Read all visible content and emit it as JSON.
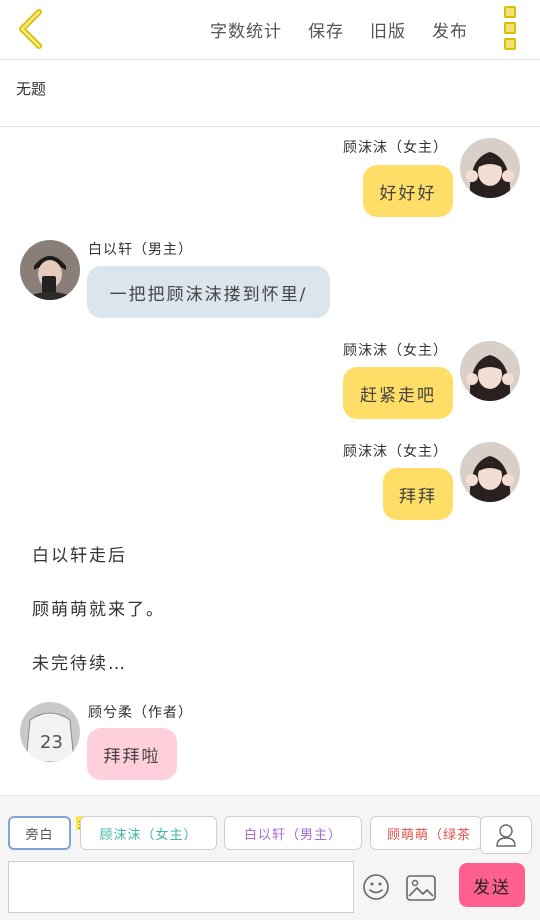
{
  "header": {
    "actions": [
      "字数统计",
      "保存",
      "旧版",
      "发布"
    ]
  },
  "title": "无题",
  "messages": [
    {
      "name": "顾沫沫（女主）",
      "text": "好好好"
    },
    {
      "name": "白以轩（男主）",
      "text": "一把把顾沫沫搂到怀里/"
    },
    {
      "name": "顾沫沫（女主）",
      "text": "赶紧走吧"
    },
    {
      "name": "顾沫沫（女主）",
      "text": "拜拜"
    },
    {
      "name": "顾兮柔（作者）",
      "text": "拜拜啦"
    }
  ],
  "narration": [
    "白以轩走后",
    "顾萌萌就来了。",
    "未完待续…"
  ],
  "roles": {
    "narration": "旁白",
    "tag": "主",
    "items": [
      "顾沫沫（女主）",
      "白以轩（男主）",
      "顾萌萌（绿茶"
    ]
  },
  "input": {
    "value": "",
    "send_label": "发送"
  },
  "colors": {
    "accent_yellow": "#ffde67",
    "bubble_gray": "#dbe5ee",
    "bubble_pink": "#ffd0dc",
    "send_button": "#ff5f8f",
    "role_teal": "#3fb7a8",
    "role_purple": "#a46bd0",
    "role_red": "#e0524e"
  },
  "icons": [
    "back-chevron-icon",
    "more-icon",
    "user-icon",
    "emoji-icon",
    "image-icon"
  ]
}
